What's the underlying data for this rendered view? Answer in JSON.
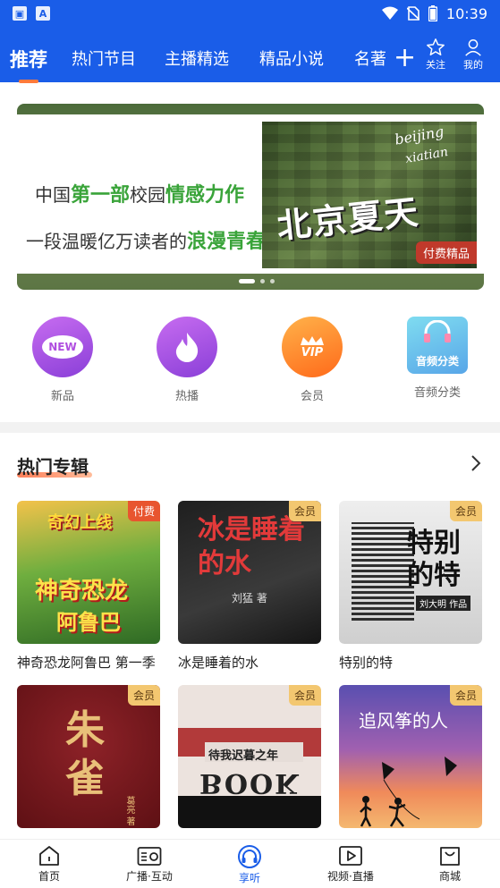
{
  "status_bar": {
    "time": "10:39",
    "left_icons": [
      "image-icon",
      "a-icon"
    ],
    "right_icons": [
      "wifi-icon",
      "no-sim-icon",
      "battery-icon"
    ]
  },
  "top_nav": {
    "tabs": [
      {
        "label": "推荐",
        "active": true
      },
      {
        "label": "热门节目",
        "active": false
      },
      {
        "label": "主播精选",
        "active": false
      },
      {
        "label": "精品小说",
        "active": false
      },
      {
        "label": "名著",
        "active": false
      }
    ],
    "plus_label": "+",
    "follow_label": "关注",
    "mine_label": "我的"
  },
  "banner": {
    "line1_prefix": "中国",
    "line1_hl1": "第一部",
    "line1_mid": "校园",
    "line1_hl2": "情感力作",
    "line2_prefix": "一段温暖亿万读者的",
    "line2_hl": "浪漫青春",
    "image_title": "北京夏天",
    "image_script1": "beijing",
    "image_script2": "xiatian",
    "badge": "付费精品"
  },
  "quick_links": [
    {
      "label": "新品",
      "icon": "new-badge-icon",
      "icon_text": "NEW"
    },
    {
      "label": "热播",
      "icon": "flame-icon"
    },
    {
      "label": "会员",
      "icon": "vip-crown-icon",
      "icon_text": "VIP"
    },
    {
      "label": "音频分类",
      "icon": "headphones-icon",
      "icon_text": "音频分类"
    }
  ],
  "section": {
    "title": "热门专辑"
  },
  "albums": [
    {
      "title": "神奇恐龙阿鲁巴 第一季",
      "tag": "付费",
      "tag_type": "paid",
      "cover_top": "奇幻上线",
      "cover_main": "神奇恐龙",
      "cover_sub": "阿鲁巴",
      "cover_color": "#3f7a2e"
    },
    {
      "title": "冰是睡着的水",
      "tag": "会员",
      "tag_type": "vip",
      "cover_main": "冰是睡着的水",
      "cover_author": "刘猛 著",
      "cover_color": "#2a2a2a"
    },
    {
      "title": "特别的特",
      "tag": "会员",
      "tag_type": "vip",
      "cover_main": "特别的特",
      "cover_author": "刘大明 作品",
      "cover_color": "#d8d8d8"
    },
    {
      "title": "",
      "tag": "会员",
      "tag_type": "vip",
      "cover_main": "朱雀",
      "cover_author": "葛亮 著",
      "cover_color": "#7a1a1f"
    },
    {
      "title": "",
      "tag": "会员",
      "tag_type": "vip",
      "cover_main": "待我迟暮之年",
      "cover_sub": "BOOK",
      "cover_color": "#e9dcd6"
    },
    {
      "title": "",
      "tag": "会员",
      "tag_type": "vip",
      "cover_main": "追风筝的人",
      "cover_color": "#6a4aa0"
    }
  ],
  "bottom_nav": [
    {
      "label": "首页",
      "icon": "home-icon",
      "active": false
    },
    {
      "label": "广播·互动",
      "icon": "radio-icon",
      "active": false
    },
    {
      "label": "享听",
      "icon": "headphones-icon",
      "active": true
    },
    {
      "label": "视频·直播",
      "icon": "video-icon",
      "active": false
    },
    {
      "label": "商城",
      "icon": "shop-bag-icon",
      "active": false
    }
  ],
  "colors": {
    "brand_blue": "#1a5de8",
    "accent_orange": "#ff7a3c",
    "vip_gold": "#f3c770",
    "paid_red": "#e8552f"
  }
}
